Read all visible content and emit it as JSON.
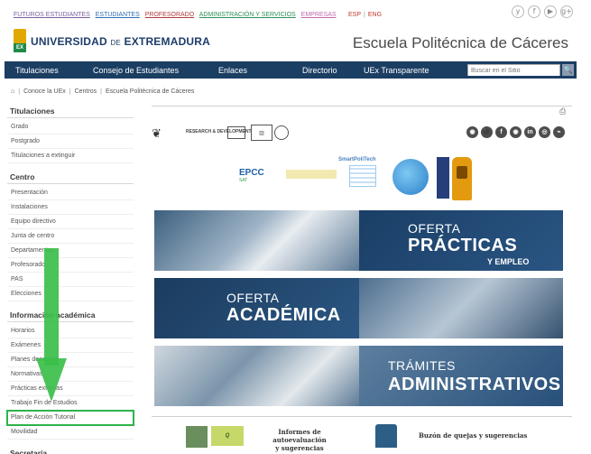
{
  "top_links": [
    "FUTUROS ESTUDIANTES",
    "ESTUDIANTES",
    "PROFESORADO",
    "ADMINISTRACIÓN Y SERVICIOS",
    "EMPRESAS"
  ],
  "lang": {
    "es": "ESP",
    "en": "ENG"
  },
  "social_top": [
    "y",
    "f",
    "▶",
    "g+"
  ],
  "logo": {
    "mark": "EX",
    "prefix": "UNIVERSIDAD",
    "de": "DE",
    "name": "EXTREMADURA"
  },
  "school_title": "Escuela Politécnica de Cáceres",
  "nav": {
    "items": [
      "Titulaciones",
      "Consejo de Estudiantes",
      "Enlaces",
      "Directorio",
      "UEx Transparente"
    ],
    "search_placeholder": "Buscar en el Sitio",
    "search_button": "🔍"
  },
  "breadcrumb": [
    "Conoce la UEx",
    "Centros",
    "Escuela Politécnica de Cáceres"
  ],
  "sidebar": {
    "sections": [
      {
        "title": "Titulaciones",
        "items": [
          "Grado",
          "Postgrado",
          "Titulaciones a extinguir"
        ]
      },
      {
        "title": "Centro",
        "items": [
          "Presentación",
          "Instalaciones",
          "Equipo directivo",
          "Junta de centro",
          "Departamentos",
          "Profesorado",
          "PAS",
          "Elecciones"
        ]
      },
      {
        "title": "Información académica",
        "items": [
          "Horarios",
          "Exámenes",
          "Planes docentes",
          "Normativas",
          "Prácticas externas",
          "Trabajo Fin de Estudios",
          "Plan de Acción Tutorial",
          "Movilidad"
        ]
      },
      {
        "title": "Secretaría",
        "items": []
      }
    ]
  },
  "brand_logos": {
    "research": "RESEARCH & DEVELOPMENT",
    "social": [
      "◉",
      "⚫",
      "f",
      "◉",
      "in",
      "◎",
      "⌁"
    ]
  },
  "partner_logos": {
    "epcc": "EPCC",
    "epcc_sub": "SAT",
    "smartpolitech": "SmartPoliTech"
  },
  "banners": [
    {
      "line1": "OFERTA",
      "line2": "PRÁCTICAS",
      "line3": "Y EMPLEO"
    },
    {
      "line1": "OFERTA",
      "line2": "ACADÉMICA"
    },
    {
      "line1": "TRÁMITES",
      "line2": "ADMINISTRATIVOS"
    }
  ],
  "bottom": {
    "informes_line1": "Informes de autoevaluación",
    "informes_line2": "y sugerencias",
    "buzon": "Buzón de quejas y sugerencias"
  },
  "colors": {
    "nav_bg": "#1b3e63",
    "highlight": "#2db34a",
    "arrow": "#3bbf4a"
  }
}
